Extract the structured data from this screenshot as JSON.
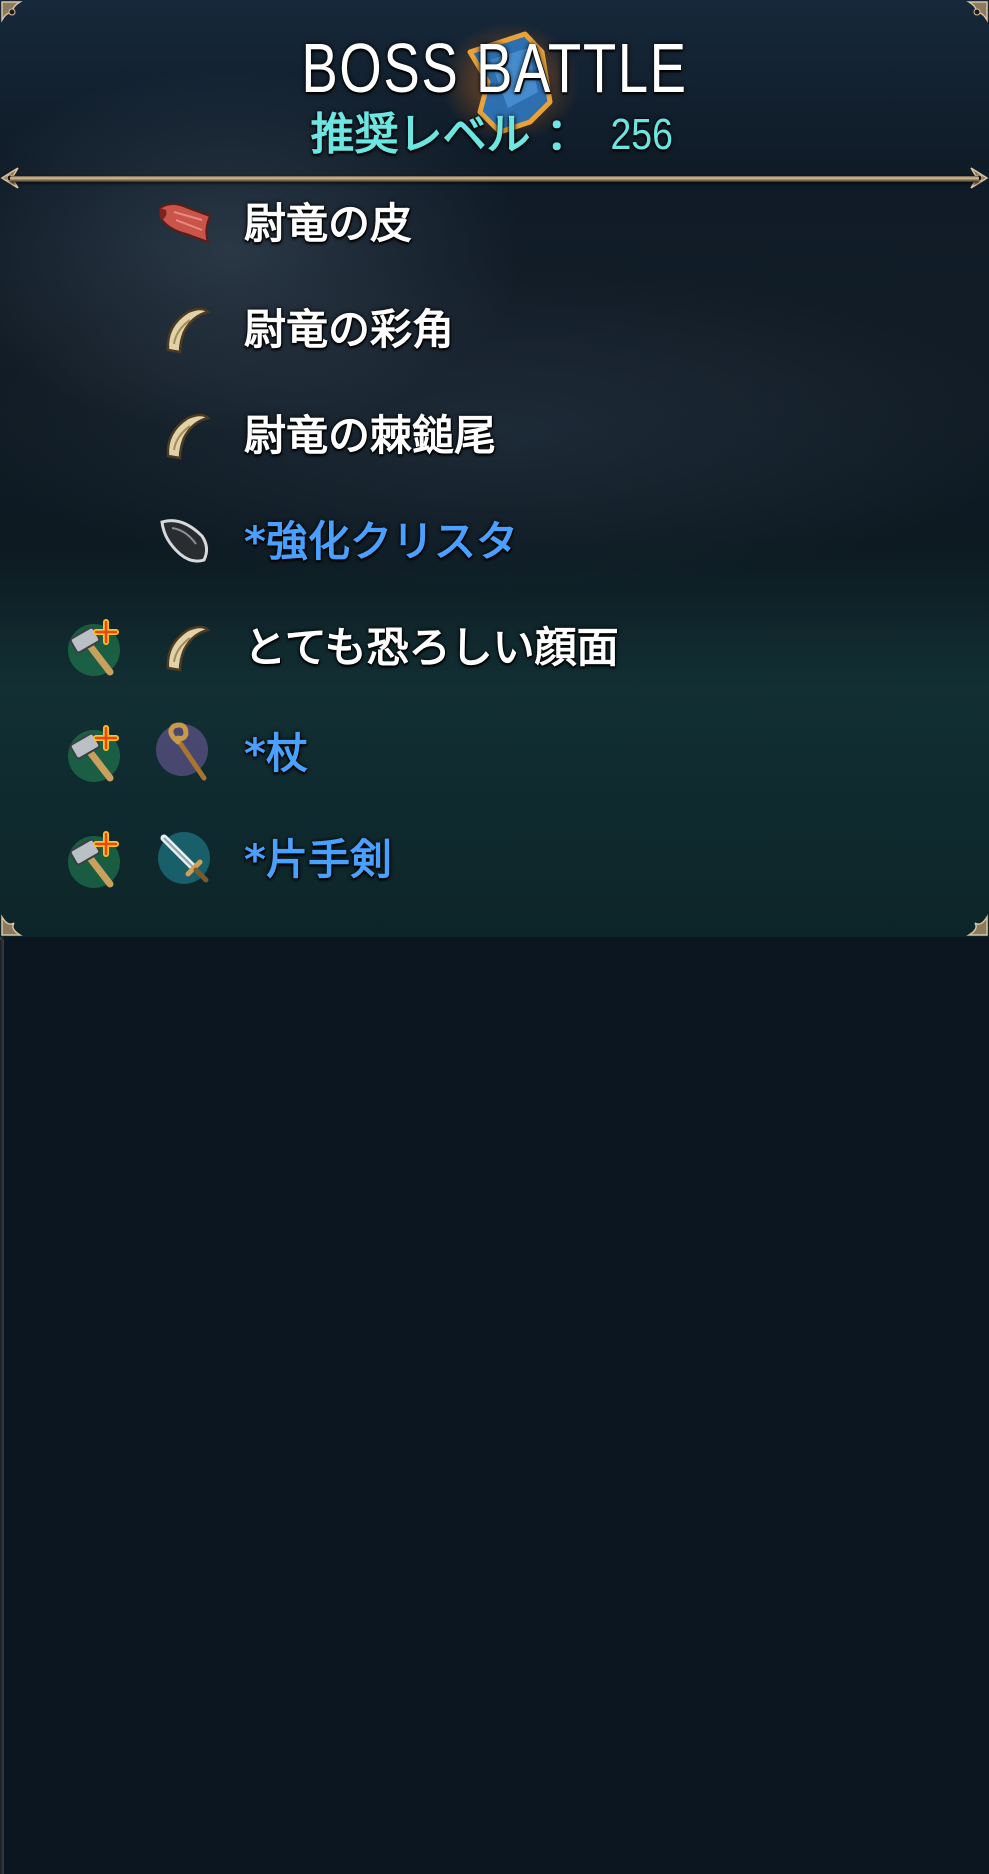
{
  "header": {
    "title": "BOSS  BATTLE",
    "recommended_label": "推奨レベル ： ",
    "recommended_level": "256",
    "emblem_icon": "boss-shoe-emblem-icon"
  },
  "drops": [
    {
      "label": "尉竜の皮",
      "icon": "hide-icon",
      "highlight": false,
      "craftable": false
    },
    {
      "label": "尉竜の彩角",
      "icon": "horn-icon",
      "highlight": false,
      "craftable": false
    },
    {
      "label": "尉竜の棘鎚尾",
      "icon": "horn-icon",
      "highlight": false,
      "craftable": false
    },
    {
      "label": "*強化クリスタ",
      "icon": "crystal-icon",
      "highlight": true,
      "craftable": false
    },
    {
      "label": "とても恐ろしい顔面",
      "icon": "horn-icon",
      "highlight": false,
      "craftable": true
    },
    {
      "label": "*杖",
      "icon": "staff-icon",
      "highlight": true,
      "craftable": true
    },
    {
      "label": "*片手剣",
      "icon": "sword-icon",
      "highlight": true,
      "craftable": true
    }
  ],
  "colors": {
    "title": "#ffffff",
    "subtitle": "#6de6e2",
    "normal_item": "#ffffff",
    "special_item": "#4aa0ff",
    "frame_gold": "#d9c3a0"
  }
}
